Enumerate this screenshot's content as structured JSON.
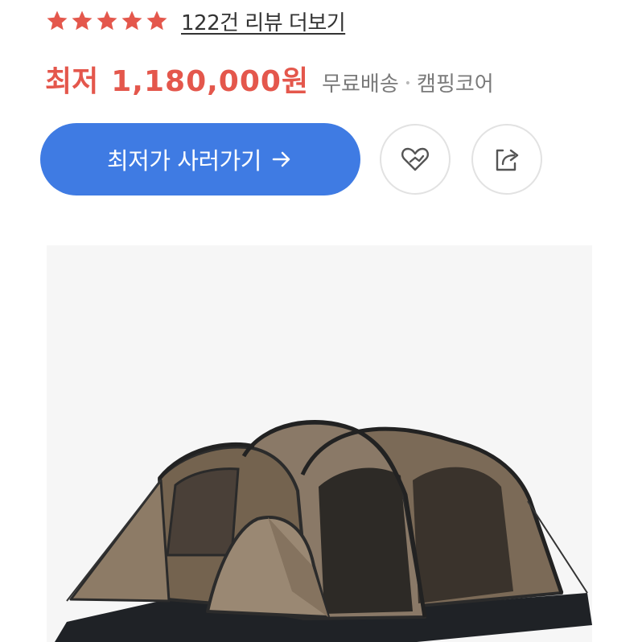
{
  "rating": {
    "stars": 5,
    "max_stars": 5,
    "star_color": "#e4574c",
    "review_link": "122건 리뷰 더보기"
  },
  "price": {
    "label": "최저",
    "value": "1,180,000원",
    "color": "#e4574c",
    "shipping": "무료배송",
    "separator": "•",
    "seller": "캠핑코어"
  },
  "actions": {
    "buy_label": "최저가 사러가기",
    "buy_color": "#3f7be3",
    "arrow_icon": "arrow-right-icon",
    "favorite_icon": "heart-icon",
    "share_icon": "share-icon"
  },
  "product": {
    "image": "tent-product-image"
  }
}
